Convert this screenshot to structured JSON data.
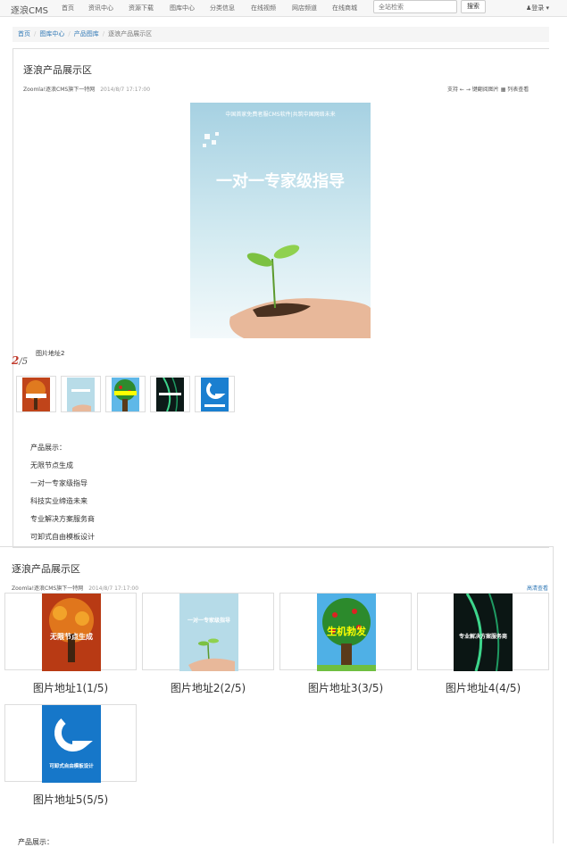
{
  "navbar": {
    "brand": "逐浪CMS",
    "items": [
      "首页",
      "资讯中心",
      "资源下载",
      "图库中心",
      "分类信息",
      "在线视频",
      "网店频道",
      "在线商城"
    ],
    "search_placeholder": "全站检索",
    "search_button": "搜索",
    "login": "登录 ▾"
  },
  "breadcrumb": [
    "首页",
    "图库中心",
    "产品图库",
    "逐浪产品展示区"
  ],
  "article": {
    "title": "逐浪产品展示区",
    "author": "Zoomla!逐浪CMS旗下一特网",
    "date": "2014/8/7 17:17:00",
    "support_text": "支持 ← → 键翻阅图片",
    "list_view": "列表查看",
    "main_image_top_text": "中国首家免费者服CMS软件|共筑中国网络未来",
    "main_image_headline": "一对一专家级指导",
    "counter_current": "2",
    "counter_total": "/5",
    "image_caption": "图片地址2",
    "description": [
      "产品展示：",
      "无限节点生成",
      "一对一专家级指导",
      "科技实业缔造未来",
      "专业解决方案服务商",
      "可卸式自由模板设计"
    ]
  },
  "gallery": {
    "title": "逐浪产品展示区",
    "author": "Zoomla!逐浪CMS旗下一特网",
    "date": "2014/8/7 17:17:00",
    "hd_link": "高清查看",
    "items": [
      {
        "label": "图片地址1(1/5)",
        "image_text": "无限节点生成"
      },
      {
        "label": "图片地址2(2/5)",
        "image_text": "一对一专家级指导"
      },
      {
        "label": "图片地址3(3/5)",
        "image_text": "生机勃发"
      },
      {
        "label": "图片地址4(4/5)",
        "image_text": "专业解决方案服务商"
      },
      {
        "label": "图片地址5(5/5)",
        "image_text": "可卸式自由模板设计"
      }
    ],
    "cut_text": "产品展示："
  },
  "colors": {
    "link": "#337ab7",
    "counter": "#c0392b",
    "sky": "#a9d3e3"
  }
}
